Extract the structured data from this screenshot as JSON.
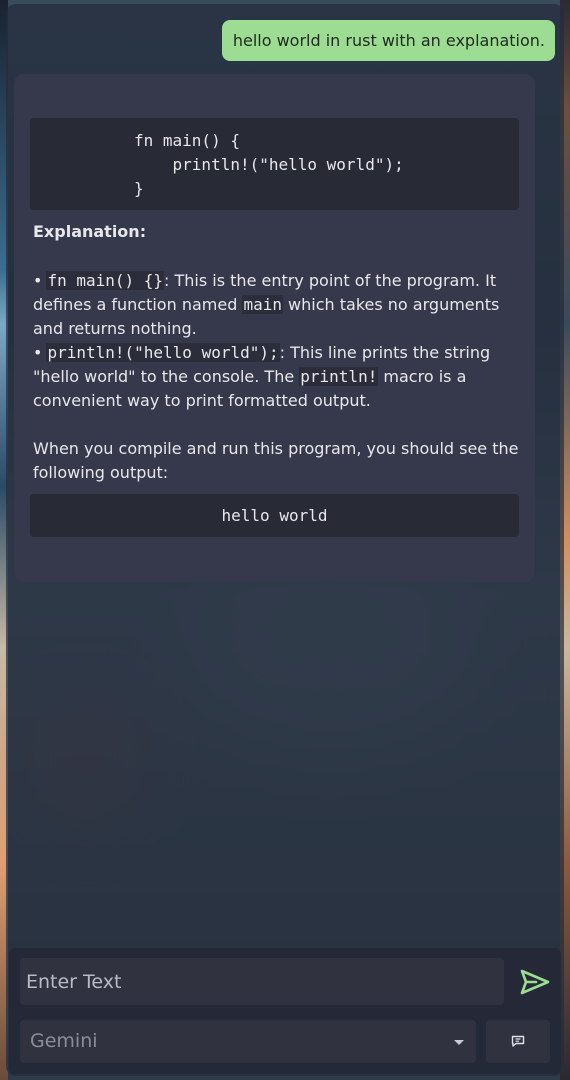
{
  "chat": {
    "user_message": "hello world in rust with an explanation.",
    "assistant": {
      "code_lines": [
        "fn main() {",
        "    println!(\"hello world\");",
        "}"
      ],
      "heading": "Explanation:",
      "bullet_1": {
        "code": "fn main() {}",
        "text_a": ": This is the entry point of the program. It defines a function named ",
        "code_inline": "main",
        "text_b": " which takes no arguments and returns nothing."
      },
      "bullet_2": {
        "code": "println!(\"hello world\");",
        "text_a": ": This line prints the string \"hello world\" to the console. The ",
        "code_inline": "println!",
        "text_b": " macro is a convenient way to print formatted output."
      },
      "paragraph": "When you compile and run this program, you should see the following output:",
      "output": "hello world"
    }
  },
  "input": {
    "placeholder": "Enter Text"
  },
  "model_select": {
    "selected": "Gemini"
  },
  "colors": {
    "user_bubble": "#9ddc93",
    "card": "#35394b",
    "code_bg": "#282a36",
    "send_icon": "#9ddc93"
  },
  "icons": {
    "send": "send-icon",
    "dropdown": "chevron-down-icon",
    "chat": "chat-bubble-icon"
  }
}
